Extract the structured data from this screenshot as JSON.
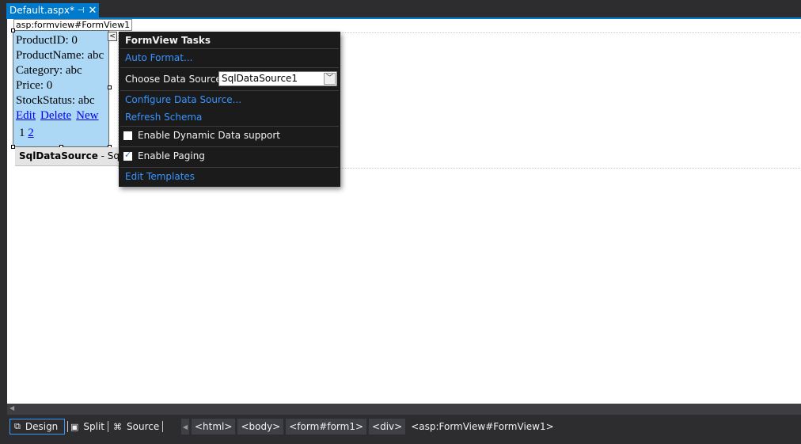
{
  "tab": {
    "title": "Default.aspx*",
    "pin_icon": "pin-icon",
    "close_icon": "close-icon"
  },
  "designer": {
    "control_tag": "asp:formview#FormView1",
    "formview": {
      "fields": [
        "ProductID: 0",
        "ProductName: abc",
        "Category: abc",
        "Price: 0",
        "StockStatus: abc"
      ],
      "links": [
        "Edit",
        "Delete",
        "New"
      ],
      "pager": [
        "1",
        "2"
      ]
    },
    "datasource": {
      "name": "SqlDataSource",
      "suffix": " - SqlDat"
    }
  },
  "tasks_panel": {
    "title": "FormView Tasks",
    "auto_format": "Auto Format...",
    "choose_label": "Choose Data Source:",
    "choose_value": "SqlDataSource1",
    "configure": "Configure Data Source...",
    "refresh": "Refresh Schema",
    "dynamic_data": {
      "label": "Enable Dynamic Data support",
      "checked": false
    },
    "paging": {
      "label": "Enable Paging",
      "checked": true
    },
    "edit_templates": "Edit Templates"
  },
  "view_bar": {
    "design": "Design",
    "split": "Split",
    "source": "Source",
    "breadcrumbs": [
      "<html>",
      "<body>",
      "<form#form1>",
      "<div>",
      "<asp:FormView#FormView1>"
    ]
  },
  "colors": {
    "accent": "#007acc",
    "link": "#3794ff",
    "formview_bg": "#add8f5"
  }
}
